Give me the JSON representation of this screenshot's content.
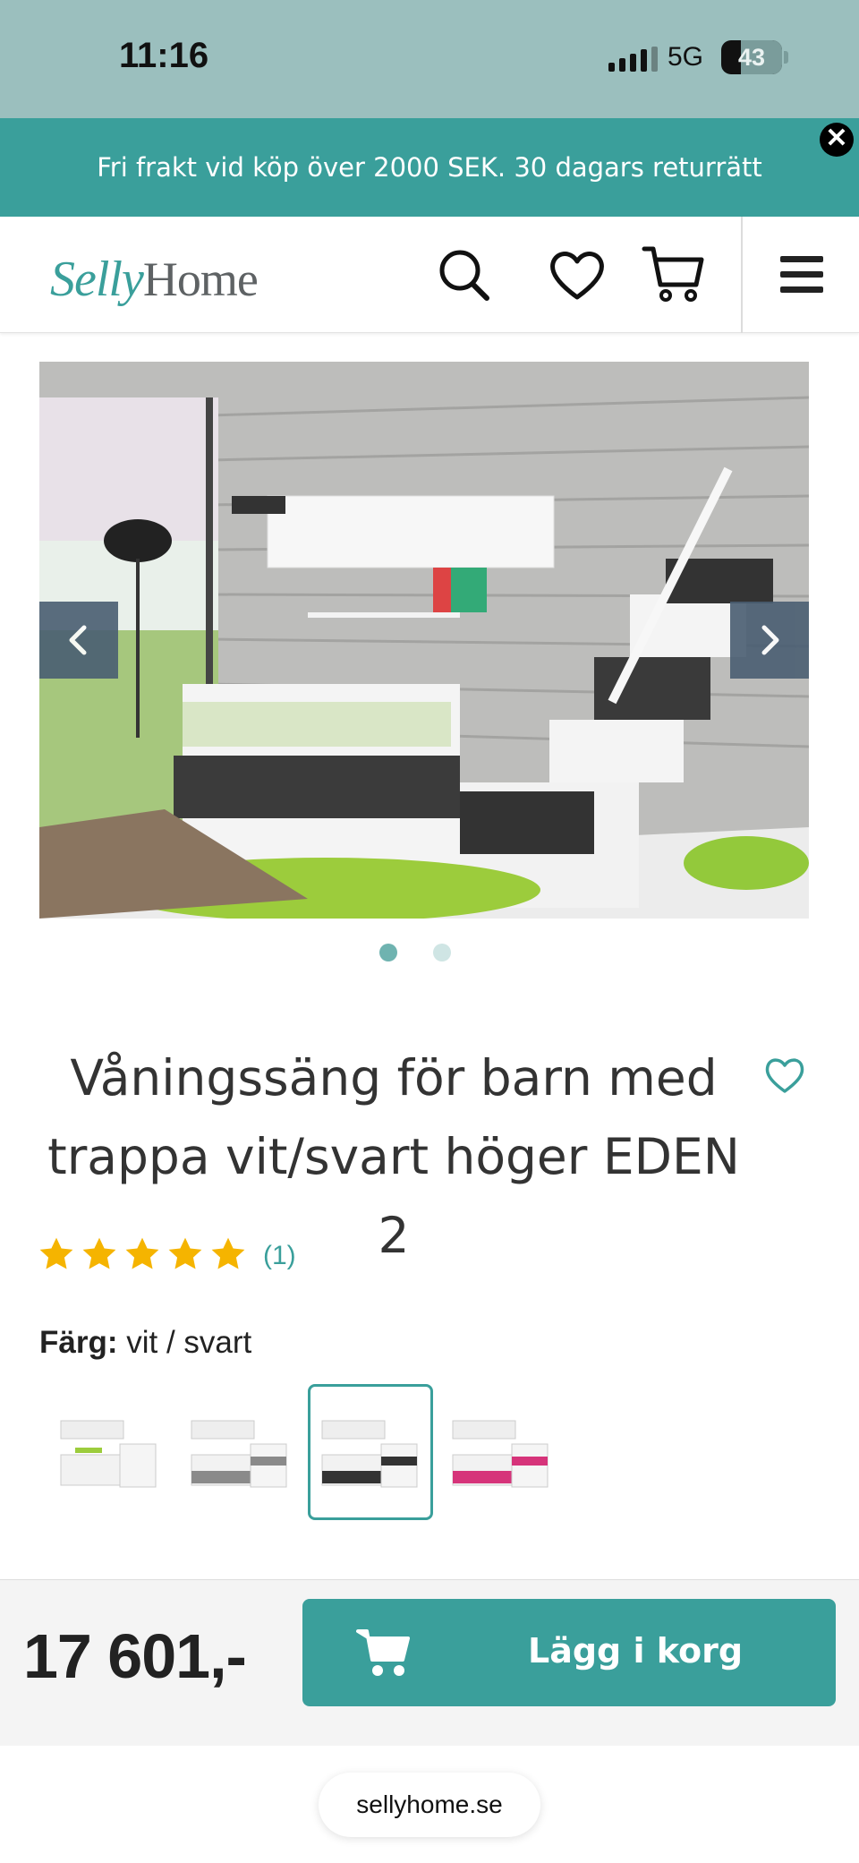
{
  "status_bar": {
    "time": "11:16",
    "network": "5G",
    "battery": "43"
  },
  "promo": {
    "text": "Fri frakt vid köp över 2000 SEK. 30 dagars returrätt"
  },
  "header": {
    "logo_script": "Selly",
    "logo_word": "Home",
    "icons": [
      "search-icon",
      "heart-icon",
      "cart-icon",
      "menu-icon"
    ]
  },
  "carousel": {
    "image_subject": "bunk-bed-product-photo",
    "slide_count": 2,
    "active_slide": 1
  },
  "product": {
    "title": "Våningssäng för barn med trappa vit/svart höger EDEN 2",
    "rating": 5,
    "review_count": "(1)",
    "color_label": "Färg:",
    "color_value": "vit / svart",
    "variants": [
      {
        "color": "#e8e8e8",
        "accent": "#f2f2f2"
      },
      {
        "color": "#8a8a8a",
        "accent": "#6e6e6e"
      },
      {
        "color": "#3a3a3a",
        "accent": "#2a2a2a"
      },
      {
        "color": "#d6347a",
        "accent": "#e05590"
      }
    ],
    "selected_variant": 2
  },
  "buy_bar": {
    "price": "17 601,-",
    "add_to_cart": "Lägg i korg"
  },
  "browser": {
    "url": "sellyhome.se"
  },
  "colors": {
    "brand": "#3a9f9b",
    "status_bg": "#9bbfbe",
    "star": "#f5b400"
  }
}
